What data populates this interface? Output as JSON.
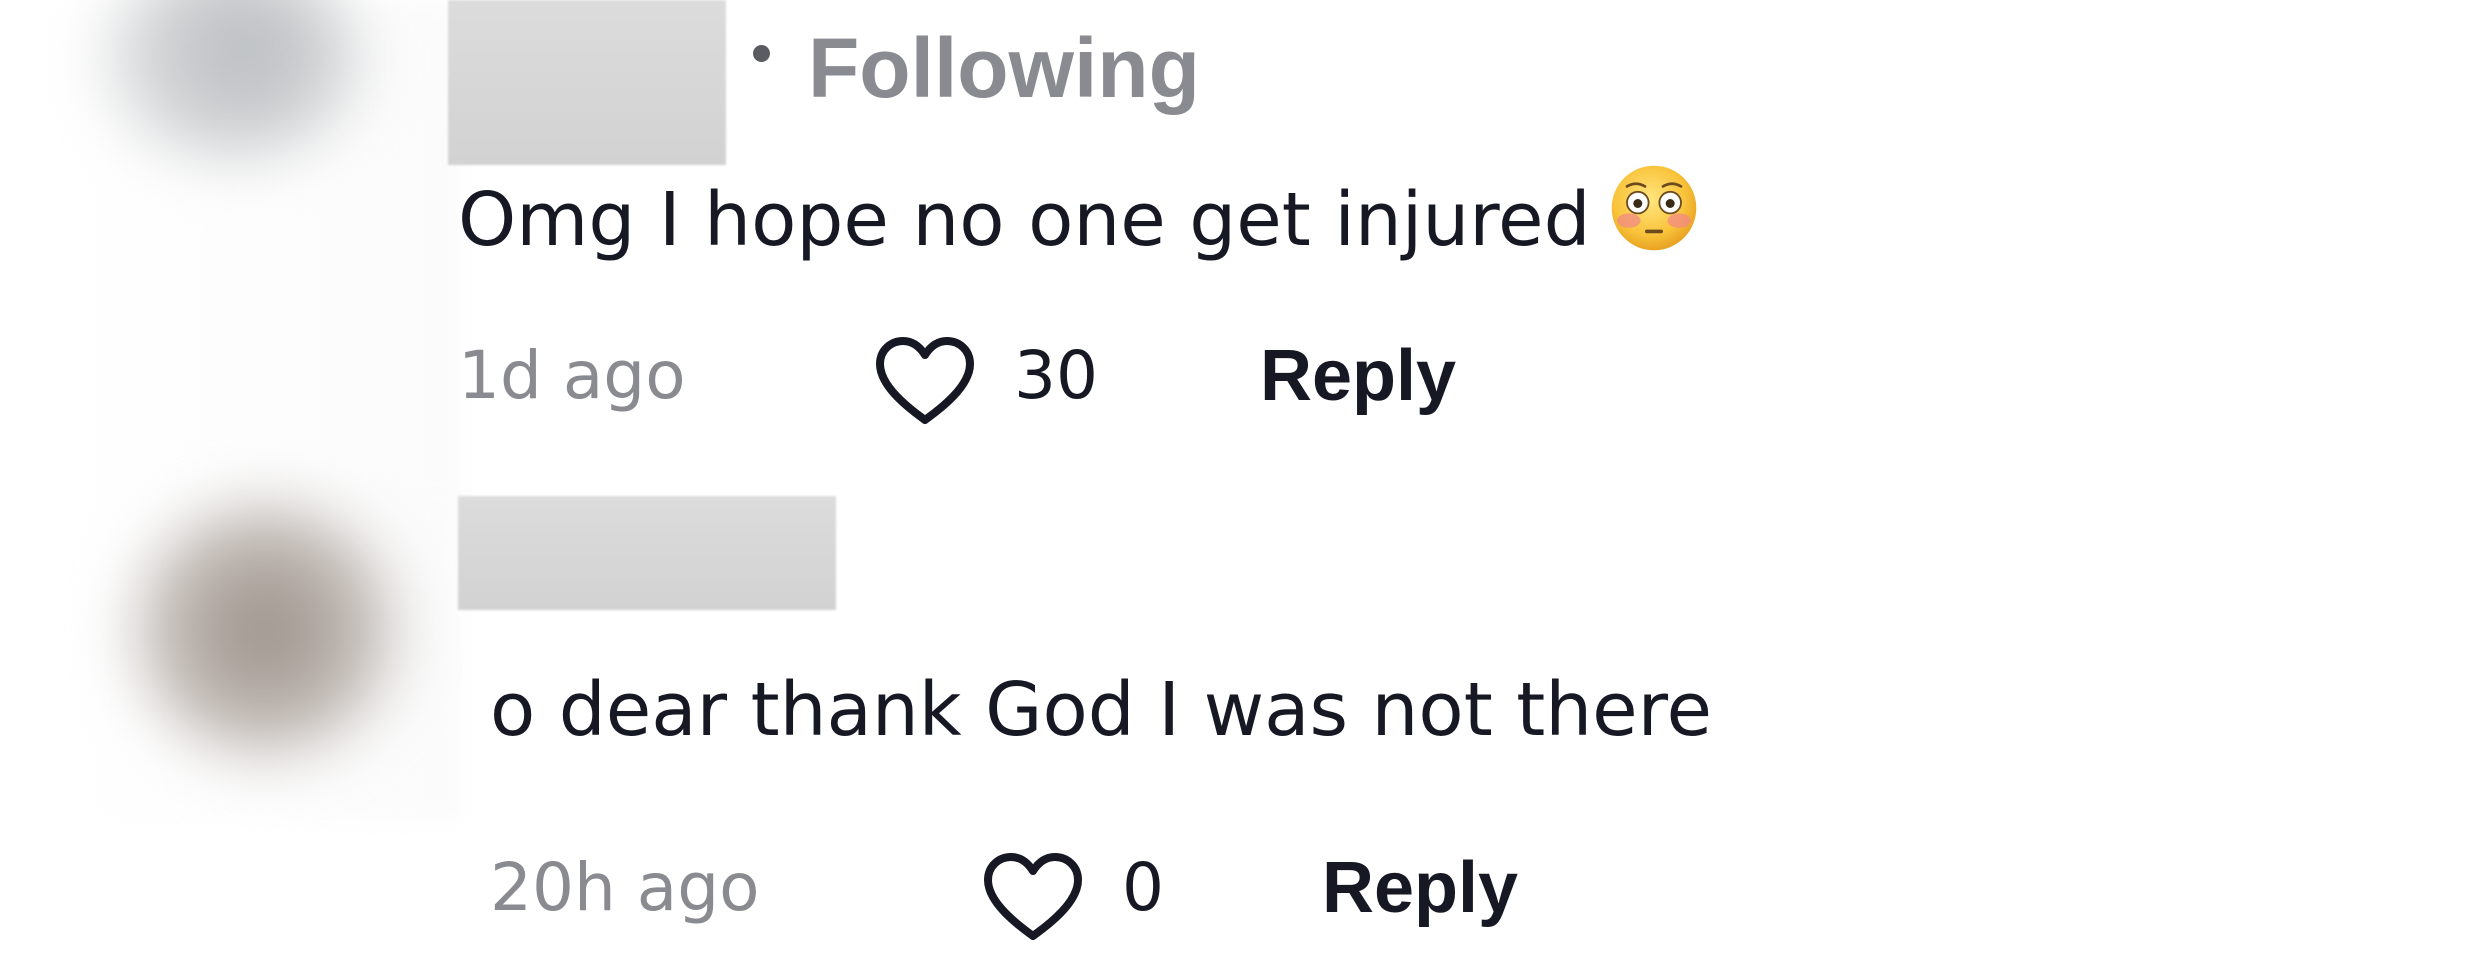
{
  "comments": [
    {
      "follow_status": "Following",
      "text": "Omg I hope no one get injured",
      "emoji_icon": "flushed-face-icon",
      "timestamp": "1d ago",
      "likes": "30",
      "reply_label": "Reply"
    },
    {
      "text": "o dear thank God I was not there",
      "timestamp": "20h ago",
      "likes": "0",
      "reply_label": "Reply"
    }
  ],
  "colors": {
    "primary_text": "#161823",
    "secondary_text": "#8a8b91",
    "background": "#ffffff"
  }
}
